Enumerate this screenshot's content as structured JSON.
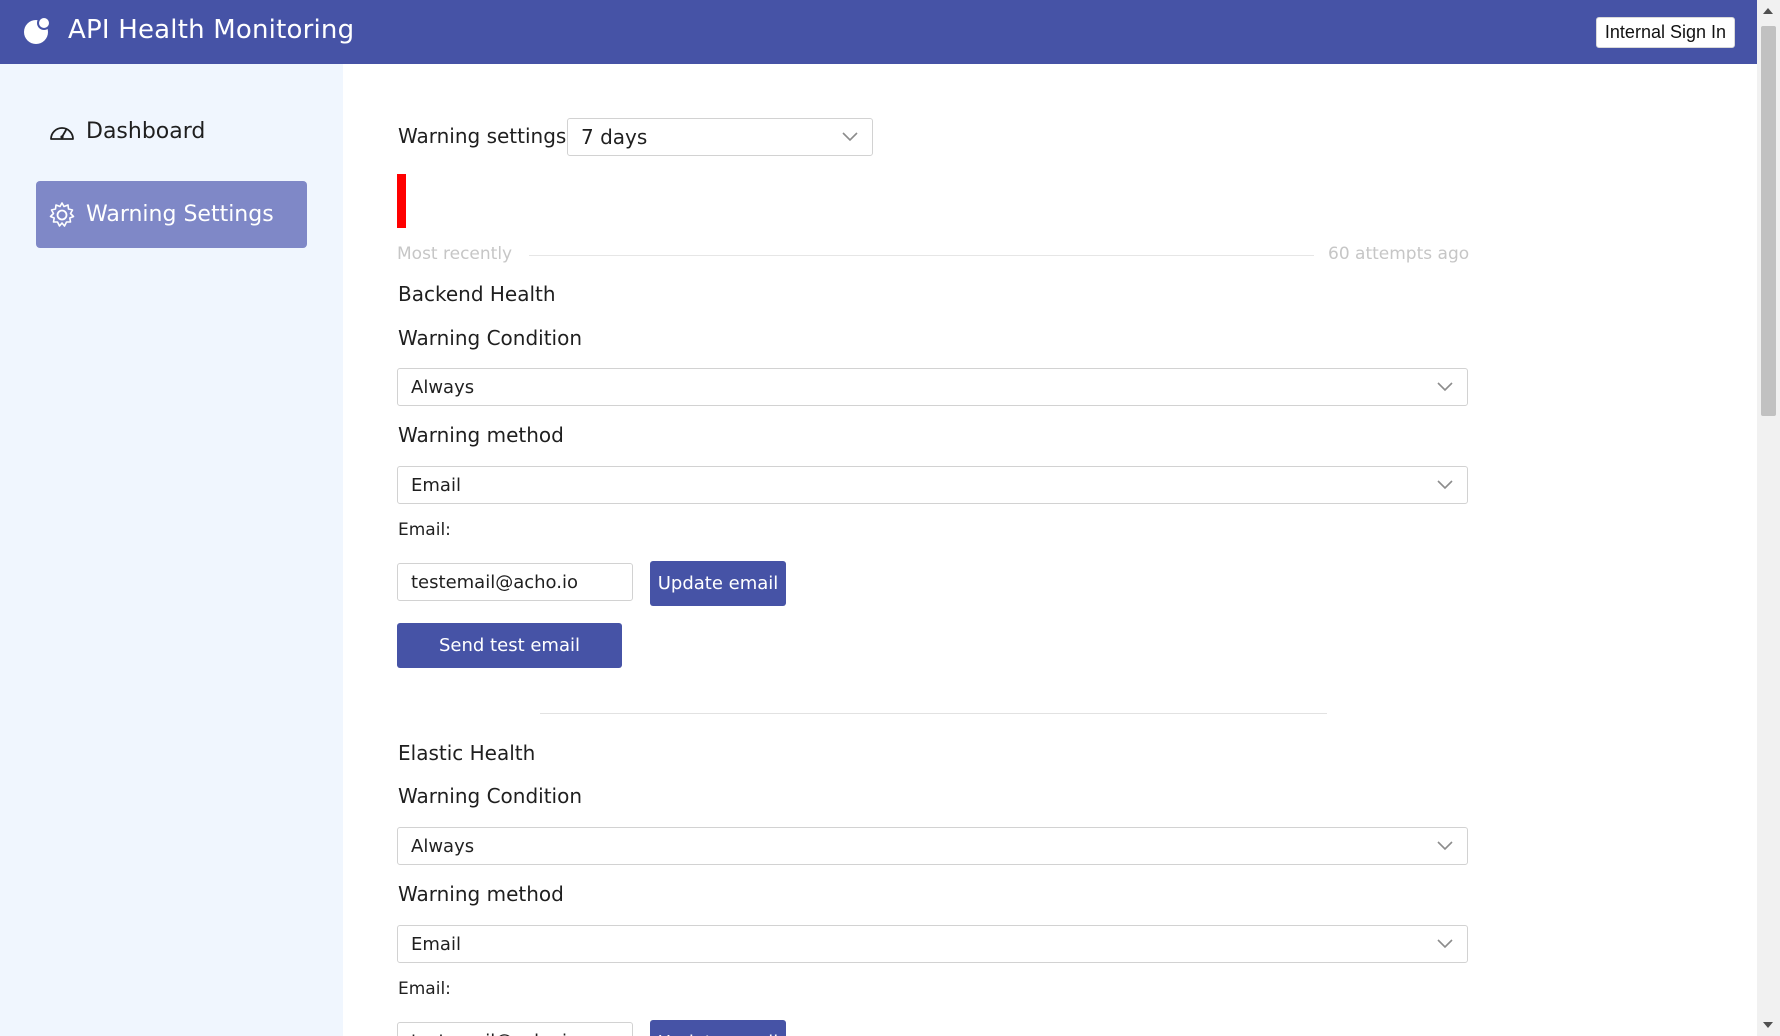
{
  "header": {
    "app_title": "API Health Monitoring",
    "signin_label": "Internal Sign In",
    "brand_color": "#4653a6"
  },
  "sidebar": {
    "items": [
      {
        "label": "Dashboard",
        "icon": "dashboard-gauge-icon",
        "active": false
      },
      {
        "label": "Warning Settings",
        "icon": "gear-icon",
        "active": true
      }
    ]
  },
  "main": {
    "period_label": "Warning settings",
    "period_value": "7 days",
    "timeline": {
      "left": "Most recently",
      "right": "60 attempts ago"
    },
    "sections": [
      {
        "title": "Backend Health",
        "condition_label": "Warning Condition",
        "condition_value": "Always",
        "method_label": "Warning method",
        "method_value": "Email",
        "email_label": "Email:",
        "email_value": "testemail@acho.io",
        "update_button": "Update email",
        "test_button": "Send test email"
      },
      {
        "title": "Elastic Health",
        "condition_label": "Warning Condition",
        "condition_value": "Always",
        "method_label": "Warning method",
        "method_value": "Email",
        "email_label": "Email:",
        "email_value": "testemail@acho.io",
        "update_button": "Update email"
      }
    ]
  }
}
